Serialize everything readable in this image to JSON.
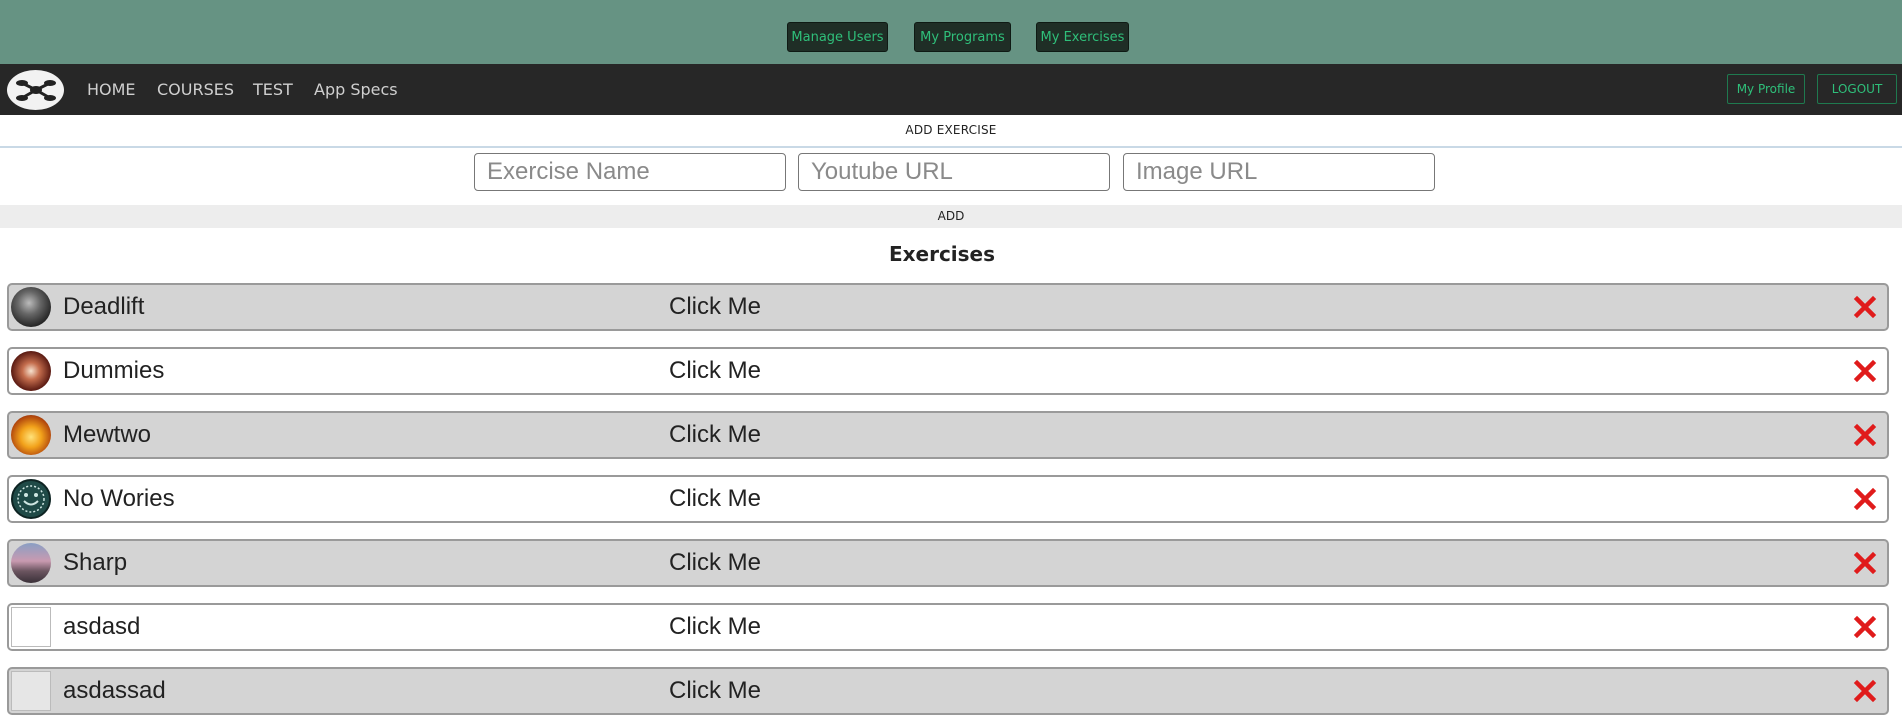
{
  "topbar": {
    "buttons": [
      "Manage Users",
      "My Programs",
      "My Exercises"
    ]
  },
  "navbar": {
    "logo_icon": "drone-logo-icon",
    "links": [
      "HOME",
      "COURSES",
      "TEST",
      "App Specs"
    ],
    "profile_label": "My Profile",
    "logout_label": "LOGOUT"
  },
  "add_exercise": {
    "header": "ADD EXERCISE",
    "name_placeholder": "Exercise Name",
    "youtube_placeholder": "Youtube URL",
    "image_placeholder": "Image URL",
    "add_label": "ADD"
  },
  "exercises": {
    "title": "Exercises",
    "delete_icon": "close-icon",
    "delete_color": "#e01b1b",
    "items": [
      {
        "name": "Deadlift",
        "action": "Click Me"
      },
      {
        "name": "Dummies",
        "action": "Click Me"
      },
      {
        "name": "Mewtwo",
        "action": "Click Me"
      },
      {
        "name": "No Wories",
        "action": "Click Me"
      },
      {
        "name": "Sharp",
        "action": "Click Me"
      },
      {
        "name": "asdasd",
        "action": "Click Me"
      },
      {
        "name": "asdassad",
        "action": "Click Me"
      }
    ]
  },
  "colors": {
    "topbar_bg": "#669383",
    "navbar_bg": "#272727",
    "accent_green": "#2fbf7a"
  }
}
